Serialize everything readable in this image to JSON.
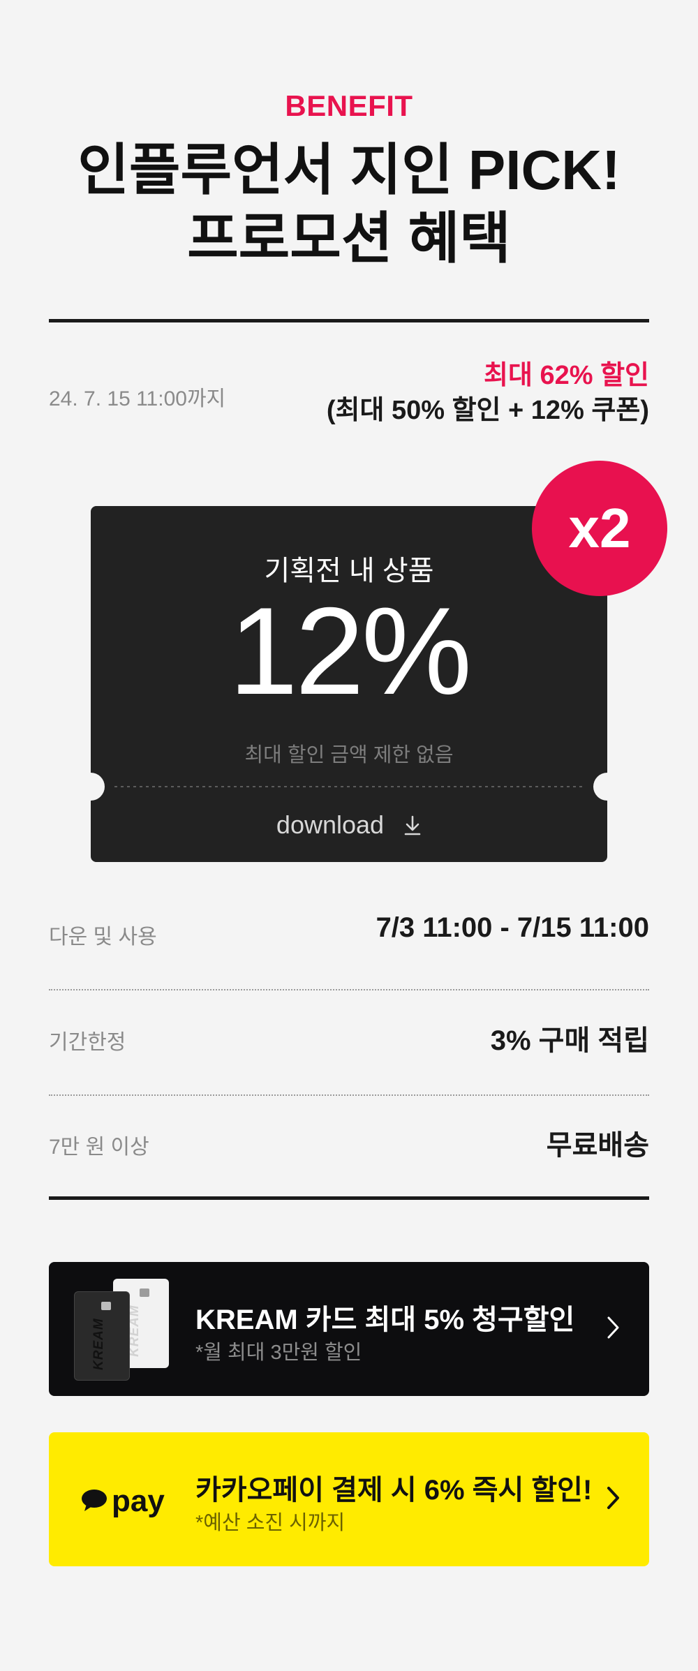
{
  "header": {
    "eyebrow": "BENEFIT",
    "title_line1": "인플루언서 지인 PICK!",
    "title_line2": "프로모션 혜택"
  },
  "summary": {
    "deadline": "24. 7. 15 11:00까지",
    "max_discount": "최대 62% 할인",
    "breakdown": "(최대 50% 할인 + 12% 쿠폰)"
  },
  "coupon": {
    "label": "기획전 내 상품",
    "value": "12%",
    "note": "최대 할인 금액 제한 없음",
    "download_label": "download",
    "multiplier": "x2"
  },
  "info_rows": [
    {
      "key": "다운 및 사용",
      "value": "7/3 11:00  - 7/15 11:00"
    },
    {
      "key": "기간한정",
      "value": "3% 구매 적립"
    },
    {
      "key": "7만 원 이상",
      "value": "무료배송"
    }
  ],
  "promos": {
    "kream": {
      "title": "KREAM 카드 최대 5% 청구할인",
      "subtitle": "*월 최대 3만원 할인",
      "card_text": "KREAM"
    },
    "kakao": {
      "logo_text": "pay",
      "title": "카카오페이 결제 시 6% 즉시 할인!",
      "subtitle": "*예산 소진 시까지"
    }
  },
  "colors": {
    "accent": "#e8134e",
    "coupon_bg": "#222222",
    "kream_bg": "#0d0d0f",
    "kakao_bg": "#ffeb00",
    "page_bg": "#f4f4f4"
  }
}
